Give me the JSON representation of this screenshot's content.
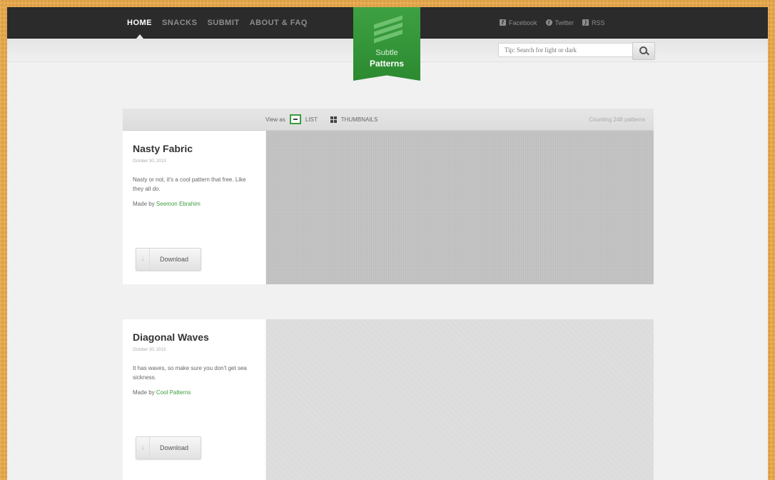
{
  "nav": {
    "items": [
      "HOME",
      "SNACKS",
      "SUBMIT",
      "ABOUT & FAQ"
    ],
    "active": "HOME"
  },
  "logo": {
    "line1": "Subtle",
    "line2": "Patterns"
  },
  "social": [
    {
      "icon": "facebook-icon",
      "label": "Facebook"
    },
    {
      "icon": "twitter-icon",
      "label": "Twitter"
    },
    {
      "icon": "rss-icon",
      "label": "RSS"
    }
  ],
  "search": {
    "placeholder": "Tip: Search for light or dark"
  },
  "viewbar": {
    "view_as": "View as",
    "list_label": "LIST",
    "thumbnails_label": "THUMBNAILS",
    "count": "Counting 248 patterns"
  },
  "patterns": [
    {
      "title": "Nasty Fabric",
      "date": "October 30, 2013",
      "description": "Nasty or not, it's a cool pattern that free. Like they all do.",
      "made_by_prefix": "Made by",
      "author": "Seemon Ebrahim",
      "download": "Download"
    },
    {
      "title": "Diagonal Waves",
      "date": "October 30, 2013",
      "description": "It has waves, so make sure you don't get sea sickness.",
      "made_by_prefix": "Made by",
      "author": "Cool Patterns",
      "download": "Download"
    }
  ],
  "colors": {
    "accent": "#3c9c3e",
    "topbar": "#2b2b2b",
    "backdrop": "#e9a94a"
  }
}
